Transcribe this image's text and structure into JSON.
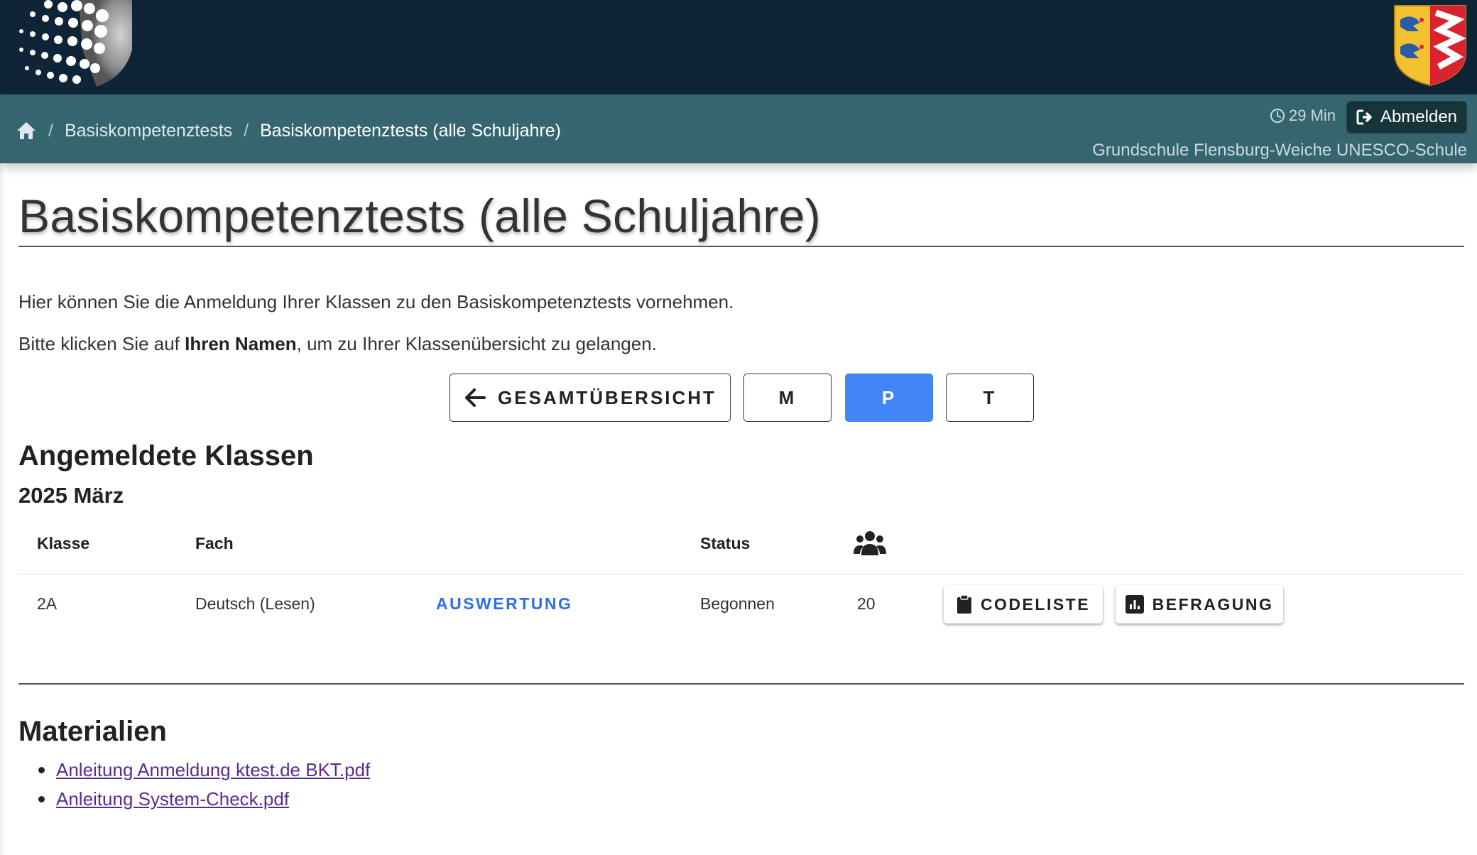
{
  "header": {
    "logo_icon": "dotted-sphere-logo",
    "crest_icon": "schleswig-holstein-crest",
    "colors": {
      "topbar": "#0f2436",
      "navbar": "#366570",
      "primary": "#4285f4",
      "link": "#2f6fe6",
      "visited_link": "#5b2c8f"
    }
  },
  "nav": {
    "home_icon": "home-icon",
    "breadcrumbs": [
      "Basiskompetenztests",
      "Basiskompetenztests (alle Schuljahre)"
    ],
    "separator": "/",
    "timer": "29 Min",
    "logout_label": "Abmelden",
    "school_name": "Grundschule Flensburg-Weiche UNESCO-Schule"
  },
  "page": {
    "title": "Basiskompetenztests (alle Schuljahre)",
    "intro": "Hier können Sie die Anmeldung Ihrer Klassen zu den Basiskompetenztests vornehmen.",
    "instruction_before": "Bitte klicken Sie auf ",
    "instruction_bold": "Ihren Namen",
    "instruction_after": ", um zu Ihrer Klassenübersicht zu gelangen."
  },
  "filter_buttons": {
    "back_label": "GESAMTÜBERSICHT",
    "letters": [
      "M",
      "P",
      "T"
    ],
    "selected": "P"
  },
  "registered": {
    "heading": "Angemeldete Klassen",
    "period": "2025 März",
    "columns": {
      "class": "Klasse",
      "subject": "Fach",
      "status": "Status",
      "participants_icon": "users-icon"
    },
    "rows": [
      {
        "class": "2A",
        "subject": "Deutsch (Lesen)",
        "evaluation_label": "AUSWERTUNG",
        "status": "Begonnen",
        "participants": "20",
        "codelist_label": "CODELISTE",
        "survey_label": "BEFRAGUNG"
      }
    ]
  },
  "materials": {
    "heading": "Materialien",
    "items": [
      "Anleitung Anmeldung ktest.de BKT.pdf",
      "Anleitung System-Check.pdf"
    ]
  }
}
